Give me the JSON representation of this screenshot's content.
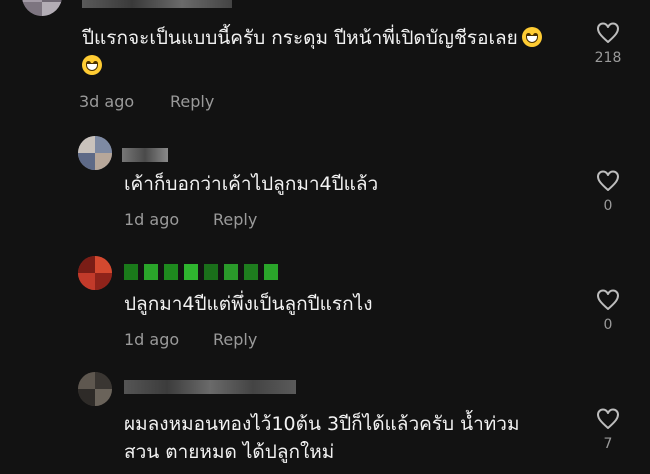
{
  "comments": [
    {
      "text": "ปีแรกจะเป็นแบบนี้ครับ กระดุม ปีหน้าพี่เปิดบัญชีรอเลย",
      "time": "3d ago",
      "reply_label": "Reply",
      "likes": "218",
      "emoji": [
        "grin-emoji",
        "grin-emoji"
      ]
    },
    {
      "text": "เค้าก็บอกว่าเค้าไปลูกมา4ปีแล้ว",
      "time": "1d ago",
      "reply_label": "Reply",
      "likes": "0"
    },
    {
      "text": "ปลูกมา4ปีแต่พึ่งเป็นลูกปีแรกไง",
      "time": "1d ago",
      "reply_label": "Reply",
      "likes": "0"
    },
    {
      "text": "ผมลงหมอนทองไว้10ต้น 3ปีก็ได้แล้วครับ น้ำท่วม\nสวน ตายหมด ได้ปลูกใหม่",
      "likes": "7"
    }
  ],
  "colors": {
    "background": "#121212",
    "text": "#f2f2f2",
    "meta": "#9a9a9a",
    "emoji": "#ffcc33"
  },
  "icons": {
    "like": "heart-outline-icon"
  }
}
